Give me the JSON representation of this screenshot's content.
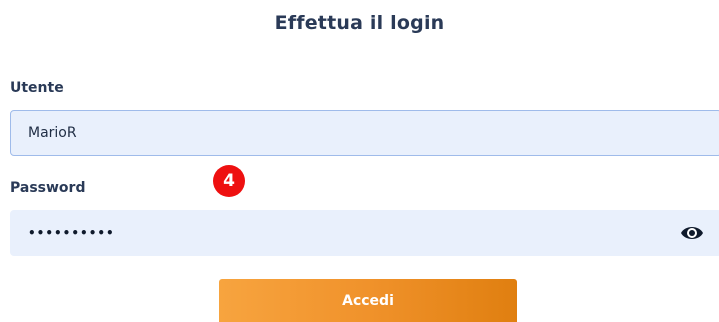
{
  "form": {
    "title": "Effettua il login",
    "user_label": "Utente",
    "user_value": "MarioR",
    "password_label": "Password",
    "password_mask": "••••••••••",
    "show_password_icon": "eye-icon",
    "submit_label": "Accedi"
  },
  "annotation": {
    "step_number": "4"
  },
  "colors": {
    "field_background": "#e9f0fc",
    "field_focus_border": "#9fbbea",
    "button_gradient_start": "#f7a43f",
    "button_gradient_end": "#e07f10",
    "badge": "#ee1010",
    "text": "#2a3a57"
  }
}
